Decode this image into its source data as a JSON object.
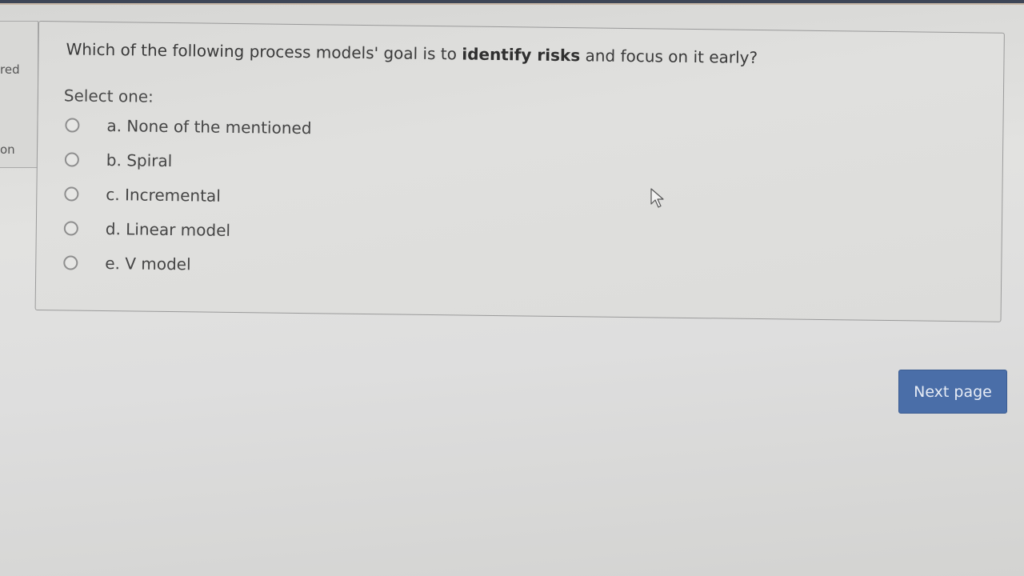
{
  "sidebar": {
    "fragment_1": "red",
    "fragment_2": "on"
  },
  "question": {
    "text_before": "Which of the following process models' goal is to ",
    "text_bold": "identify risks",
    "text_after": " and focus on it early?",
    "prompt": "Select one:"
  },
  "options": [
    {
      "label": "a. None of the mentioned",
      "selected": false
    },
    {
      "label": "b. Spiral",
      "selected": false
    },
    {
      "label": "c. Incremental",
      "selected": false
    },
    {
      "label": "d. Linear model",
      "selected": false
    },
    {
      "label": "e. V model",
      "selected": false
    }
  ],
  "navigation": {
    "next_label": "Next page"
  },
  "colors": {
    "accent": "#4a6ea8",
    "top_bar": "#424a5c"
  },
  "icons": {
    "cursor": "mouse-pointer-icon"
  }
}
